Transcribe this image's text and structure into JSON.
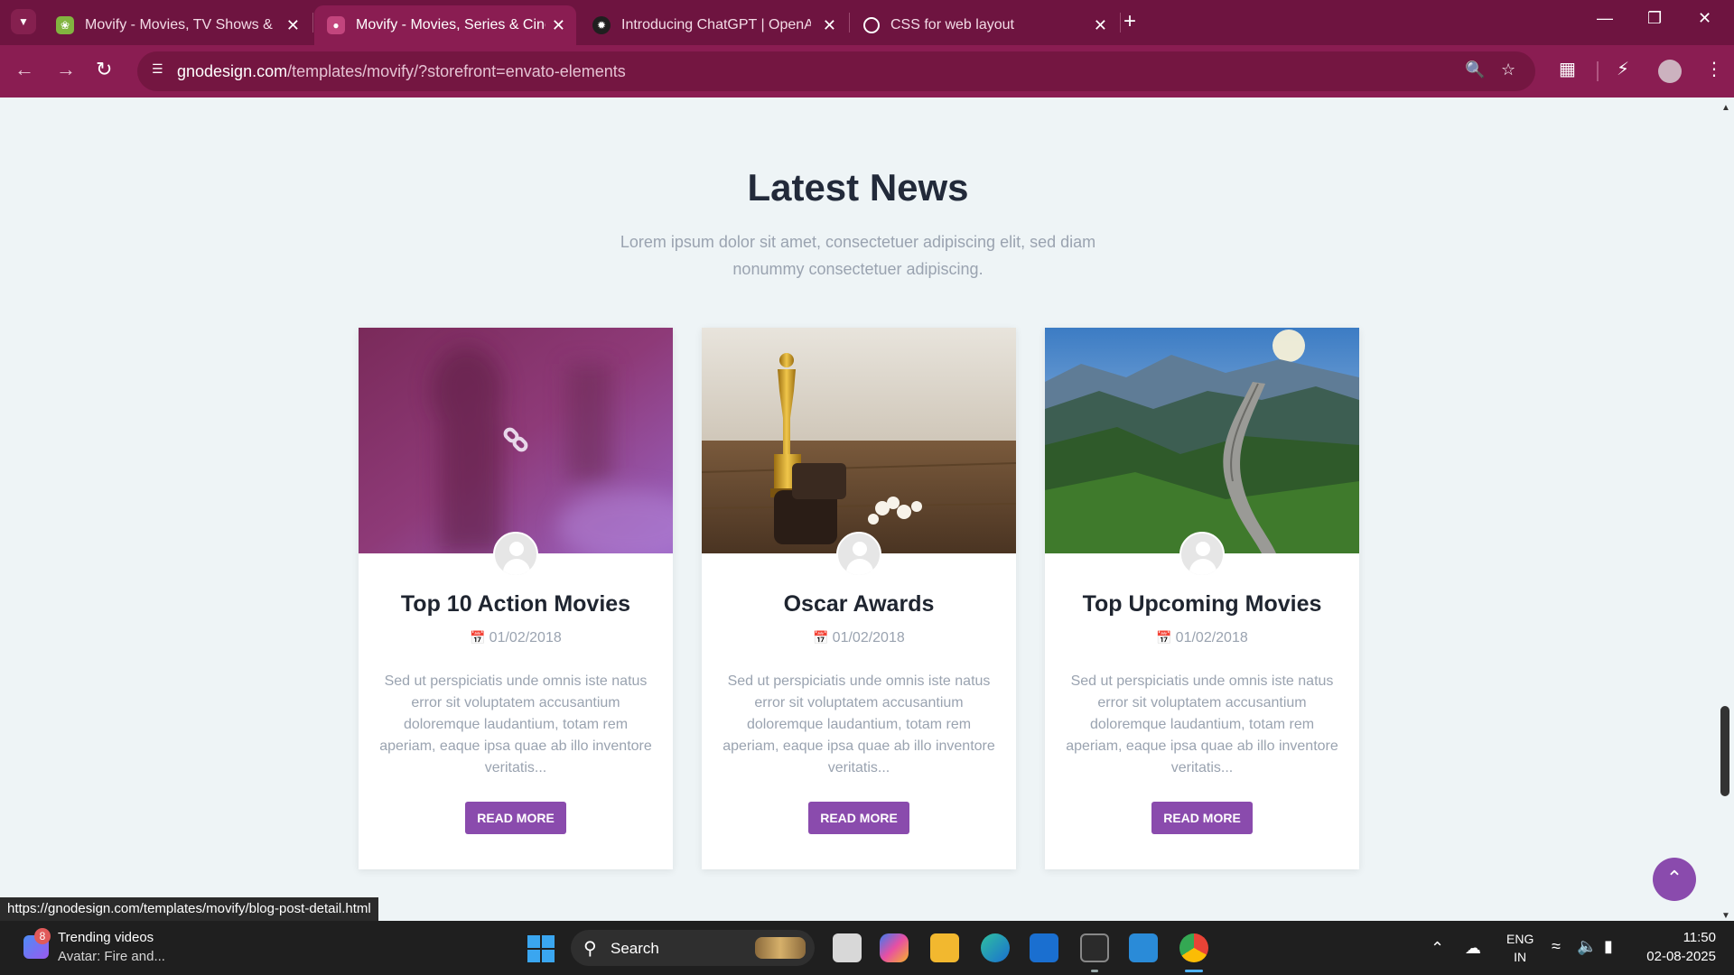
{
  "browser": {
    "tabs": [
      {
        "title": "Movify - Movies, TV Shows & C",
        "icon": "envato-icon",
        "active": false
      },
      {
        "title": "Movify - Movies, Series & Cinem",
        "icon": "gnodesign-icon",
        "active": true
      },
      {
        "title": "Introducing ChatGPT | OpenAI",
        "icon": "openai-icon",
        "active": false
      },
      {
        "title": "CSS for web layout",
        "icon": "web-icon",
        "active": false
      }
    ],
    "url_host": "gnodesign.com",
    "url_path": "/templates/movify/?storefront=envato-elements",
    "status_url": "https://gnodesign.com/templates/movify/blog-post-detail.html"
  },
  "section": {
    "title": "Latest News",
    "subtitle": "Lorem ipsum dolor sit amet, consectetuer adipiscing elit, sed diam nonummy consectetuer adipiscing."
  },
  "posts": [
    {
      "title": "Top 10 Action Movies",
      "date": "01/02/2018",
      "excerpt": "Sed ut perspiciatis unde omnis iste natus error sit voluptatem accusantium doloremque laudantium, totam rem aperiam, eaque ipsa quae ab illo inventore veritatis...",
      "button": "READ MORE"
    },
    {
      "title": "Oscar Awards",
      "date": "01/02/2018",
      "excerpt": "Sed ut perspiciatis unde omnis iste natus error sit voluptatem accusantium doloremque laudantium, totam rem aperiam, eaque ipsa quae ab illo inventore veritatis...",
      "button": "READ MORE"
    },
    {
      "title": "Top Upcoming Movies",
      "date": "01/02/2018",
      "excerpt": "Sed ut perspiciatis unde omnis iste natus error sit voluptatem accusantium doloremque laudantium, totam rem aperiam, eaque ipsa quae ab illo inventore veritatis...",
      "button": "READ MORE"
    }
  ],
  "taskbar": {
    "widget_title": "Trending videos",
    "widget_sub": "Avatar: Fire and...",
    "widget_badge": "8",
    "search_label": "Search",
    "lang_1": "ENG",
    "lang_2": "IN",
    "time": "11:50",
    "date": "02-08-2025"
  },
  "colors": {
    "accent": "#8a4bad",
    "browser_frame": "#8a1d52",
    "page_bg": "#eef4f6"
  }
}
